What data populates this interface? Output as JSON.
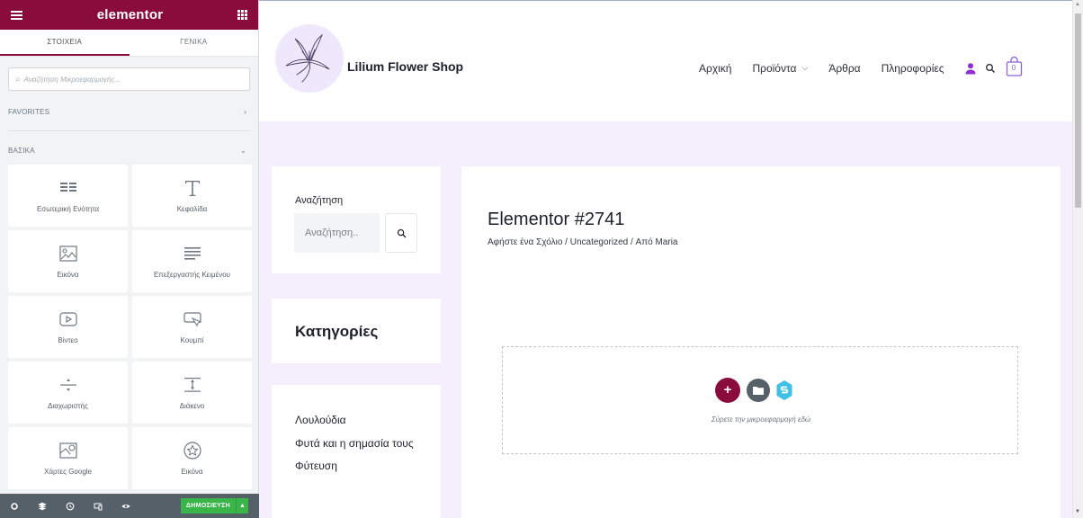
{
  "editor": {
    "logo": "elementor",
    "tabs": [
      {
        "label": "ΣΤΟΙΧΕΙΑ",
        "active": true
      },
      {
        "label": "ΓΕΝΙΚΑ",
        "active": false
      }
    ],
    "search_placeholder": "Αναζήτηση Μικροεφαρμογής...",
    "sections": [
      {
        "label": "FAVORITES",
        "state": "collapsed"
      },
      {
        "label": "ΒΑΣΙΚΑ",
        "state": "expanded"
      }
    ],
    "widgets": [
      {
        "label": "Εσωτερική Ενότητα",
        "icon": "inner-section-icon"
      },
      {
        "label": "Κεφαλίδα",
        "icon": "heading-icon"
      },
      {
        "label": "Εικόνα",
        "icon": "image-icon"
      },
      {
        "label": "Επεξεργαστής Κειμένου",
        "icon": "text-editor-icon"
      },
      {
        "label": "Βίντεο",
        "icon": "video-icon"
      },
      {
        "label": "Κουμπί",
        "icon": "button-icon"
      },
      {
        "label": "Διαχωριστής",
        "icon": "divider-icon"
      },
      {
        "label": "Διάκενο",
        "icon": "spacer-icon"
      },
      {
        "label": "Χάρτες Google",
        "icon": "google-maps-icon"
      },
      {
        "label": "Εικόνα",
        "icon": "icon-widget-icon"
      }
    ],
    "footer": {
      "publish_label": "ΔΗΜΟΣΙΕΥΣΗ",
      "icons": [
        "settings-icon",
        "navigator-icon",
        "history-icon",
        "responsive-icon",
        "preview-icon"
      ]
    },
    "colors": {
      "brand": "#8a0c3c",
      "publish": "#39b54a",
      "footer": "#556068"
    }
  },
  "site": {
    "title": "Lilium Flower Shop",
    "nav": [
      {
        "label": "Αρχική",
        "dropdown": false
      },
      {
        "label": "Προϊόντα",
        "dropdown": true
      },
      {
        "label": "Άρθρα",
        "dropdown": false
      },
      {
        "label": "Πληροφορίες",
        "dropdown": false
      }
    ],
    "cart_count": "0",
    "colors": {
      "accent": "#8d62d5",
      "background": "#f5eefc"
    },
    "search": {
      "label": "Αναζήτηση",
      "placeholder": "Αναζήτηση.."
    },
    "categories_title": "Κατηγορίες",
    "categories": [
      "Λουλούδια",
      "Φυτά και η σημασία τους",
      "Φύτευση"
    ],
    "post": {
      "title": "Elementor #2741",
      "meta": "Αφήστε ένα Σχόλιο / Uncategorized / Από Maria"
    },
    "drop_zone_text": "Σύρετε την μικροεφαρμογή εδώ"
  }
}
